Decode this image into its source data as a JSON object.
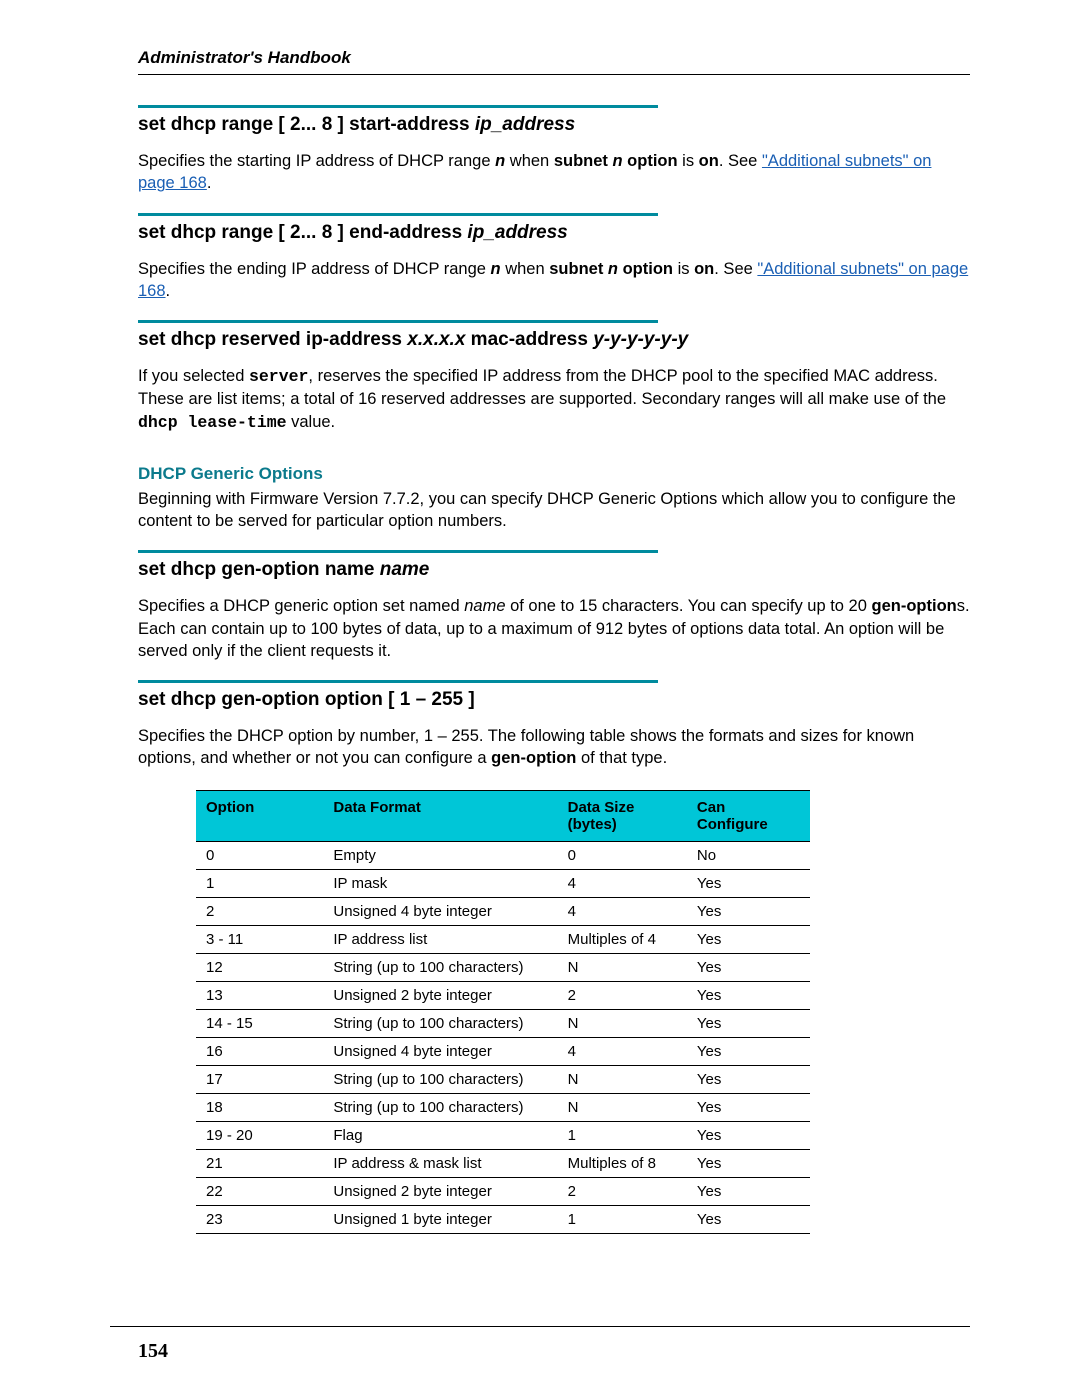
{
  "running_head": "Administrator's Handbook",
  "page_number": "154",
  "sec1": {
    "title_a": "set dhcp range [ 2... 8 ] start-address ",
    "title_b": "ip_address",
    "p_a": "Specifies the starting IP address of DHCP range ",
    "p_n": "n",
    "p_b": " when ",
    "p_sub": "subnet ",
    "p_nopt": "n",
    "p_opt": " option",
    "p_c": " is ",
    "p_on": "on",
    "p_d": ". See ",
    "link": "\"Additional subnets\" on page 168",
    "p_e": "."
  },
  "sec2": {
    "title_a": "set dhcp range [ 2... 8 ] end-address ",
    "title_b": "ip_address",
    "p_a": "Specifies the ending IP address of DHCP range ",
    "p_n": "n",
    "p_b": " when ",
    "p_sub": "subnet ",
    "p_nopt": "n",
    "p_opt": " option",
    "p_c": " is ",
    "p_on": "on",
    "p_d": ". See ",
    "link": "\"Additional subnets\" on page 168",
    "p_e": "."
  },
  "sec3": {
    "title_a": "set dhcp reserved ip-address ",
    "title_b": "x.x.x.x",
    "title_c": " mac-address ",
    "title_d": "y-y-y-y-y-y",
    "p_a": "If you selected ",
    "p_srv": "server",
    "p_b": ", reserves the specified IP address from the DHCP pool to the specified MAC address. These are list items; a total of 16 reserved addresses are supported. Secondary ranges will all make use of the ",
    "p_lease": "dhcp lease-time",
    "p_c": " value."
  },
  "generic": {
    "head": "DHCP Generic Options",
    "p": "Beginning with Firmware Version 7.7.2, you can specify DHCP Generic Options which allow you to configure the content to be served for particular option numbers."
  },
  "sec4": {
    "title_a": "set dhcp gen-option name ",
    "title_b": "name",
    "p_a": "Specifies a DHCP generic option set named ",
    "p_name": "name",
    "p_b": " of one to 15 characters. You can specify up to 20 ",
    "p_gen": "gen-option",
    "p_c": "s. Each can contain up to 100 bytes of data, up to a maximum of 912 bytes of options data total. An option will be served only if the client requests it."
  },
  "sec5": {
    "title": "set dhcp gen-option option [ 1 – 255 ]",
    "p_a": "Specifies the DHCP option by number, 1 – 255. The following table shows the formats and sizes for known options, and whether or not you can configure a ",
    "p_gen": "gen-option",
    "p_b": " of that type."
  },
  "table": {
    "headers": {
      "opt": "Option",
      "fmt": "Data Format",
      "size_a": "Data Size",
      "size_b": "(bytes)",
      "cfg_a": "Can",
      "cfg_b": "Configure"
    },
    "rows": [
      {
        "opt": "0",
        "fmt": "Empty",
        "size": "0",
        "cfg": "No"
      },
      {
        "opt": "1",
        "fmt": "IP mask",
        "size": "4",
        "cfg": "Yes"
      },
      {
        "opt": "2",
        "fmt": "Unsigned 4 byte integer",
        "size": "4",
        "cfg": "Yes"
      },
      {
        "opt": "3 - 11",
        "fmt": "IP address list",
        "size": "Multiples of 4",
        "cfg": "Yes"
      },
      {
        "opt": "12",
        "fmt": "String (up to 100 characters)",
        "size": "N",
        "cfg": "Yes"
      },
      {
        "opt": "13",
        "fmt": "Unsigned 2 byte integer",
        "size": "2",
        "cfg": "Yes"
      },
      {
        "opt": "14 - 15",
        "fmt": "String (up to 100 characters)",
        "size": "N",
        "cfg": "Yes"
      },
      {
        "opt": "16",
        "fmt": "Unsigned 4 byte integer",
        "size": "4",
        "cfg": "Yes"
      },
      {
        "opt": "17",
        "fmt": "String (up to 100 characters)",
        "size": "N",
        "cfg": "Yes"
      },
      {
        "opt": "18",
        "fmt": "String (up to 100 characters)",
        "size": "N",
        "cfg": "Yes"
      },
      {
        "opt": "19 - 20",
        "fmt": "Flag",
        "size": "1",
        "cfg": "Yes"
      },
      {
        "opt": "21",
        "fmt": "IP address & mask list",
        "size": "Multiples of 8",
        "cfg": "Yes"
      },
      {
        "opt": "22",
        "fmt": "Unsigned 2 byte integer",
        "size": "2",
        "cfg": "Yes"
      },
      {
        "opt": "23",
        "fmt": "Unsigned 1 byte integer",
        "size": "1",
        "cfg": "Yes"
      }
    ]
  }
}
